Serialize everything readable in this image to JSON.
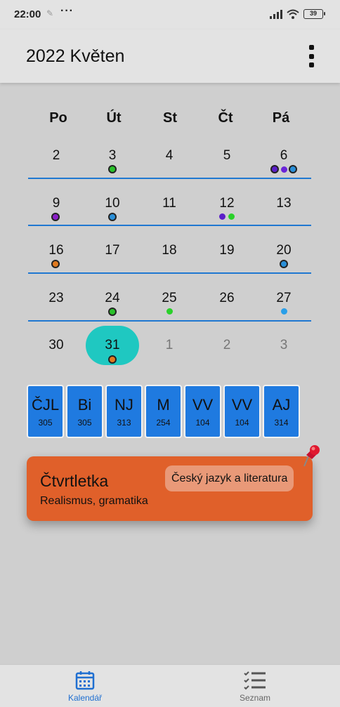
{
  "status_bar": {
    "time": "22:00",
    "more": "···",
    "battery": "39"
  },
  "app_bar": {
    "title": "2022 Květen"
  },
  "calendar": {
    "weekdays": [
      "Po",
      "Út",
      "St",
      "Čt",
      "Pá"
    ],
    "weeks": [
      [
        "2",
        "3",
        "4",
        "5",
        "6"
      ],
      [
        "9",
        "10",
        "11",
        "12",
        "13"
      ],
      [
        "16",
        "17",
        "18",
        "19",
        "20"
      ],
      [
        "23",
        "24",
        "25",
        "26",
        "27"
      ],
      [
        "30",
        "31",
        "1",
        "2",
        "3"
      ]
    ],
    "selected_day": "31",
    "colors": {
      "today": "#1fc8c1",
      "week_line": "#1f78d1"
    }
  },
  "subjects": [
    {
      "name": "ČJL",
      "room": "305"
    },
    {
      "name": "Bi",
      "room": "305"
    },
    {
      "name": "NJ",
      "room": "313"
    },
    {
      "name": "M",
      "room": "254"
    },
    {
      "name": "VV",
      "room": "104"
    },
    {
      "name": "VV",
      "room": "104"
    },
    {
      "name": "AJ",
      "room": "314"
    }
  ],
  "event": {
    "title": "Čtvrtletka",
    "subject": "Český jazyk a literatura",
    "description": "Realismus, gramatika",
    "color": "#e0602a",
    "icon": "pushpin-icon"
  },
  "bottom_nav": {
    "items": [
      {
        "label": "Kalendář",
        "icon": "calendar-icon",
        "active": true
      },
      {
        "label": "Seznam",
        "icon": "checklist-icon",
        "active": false
      }
    ]
  }
}
